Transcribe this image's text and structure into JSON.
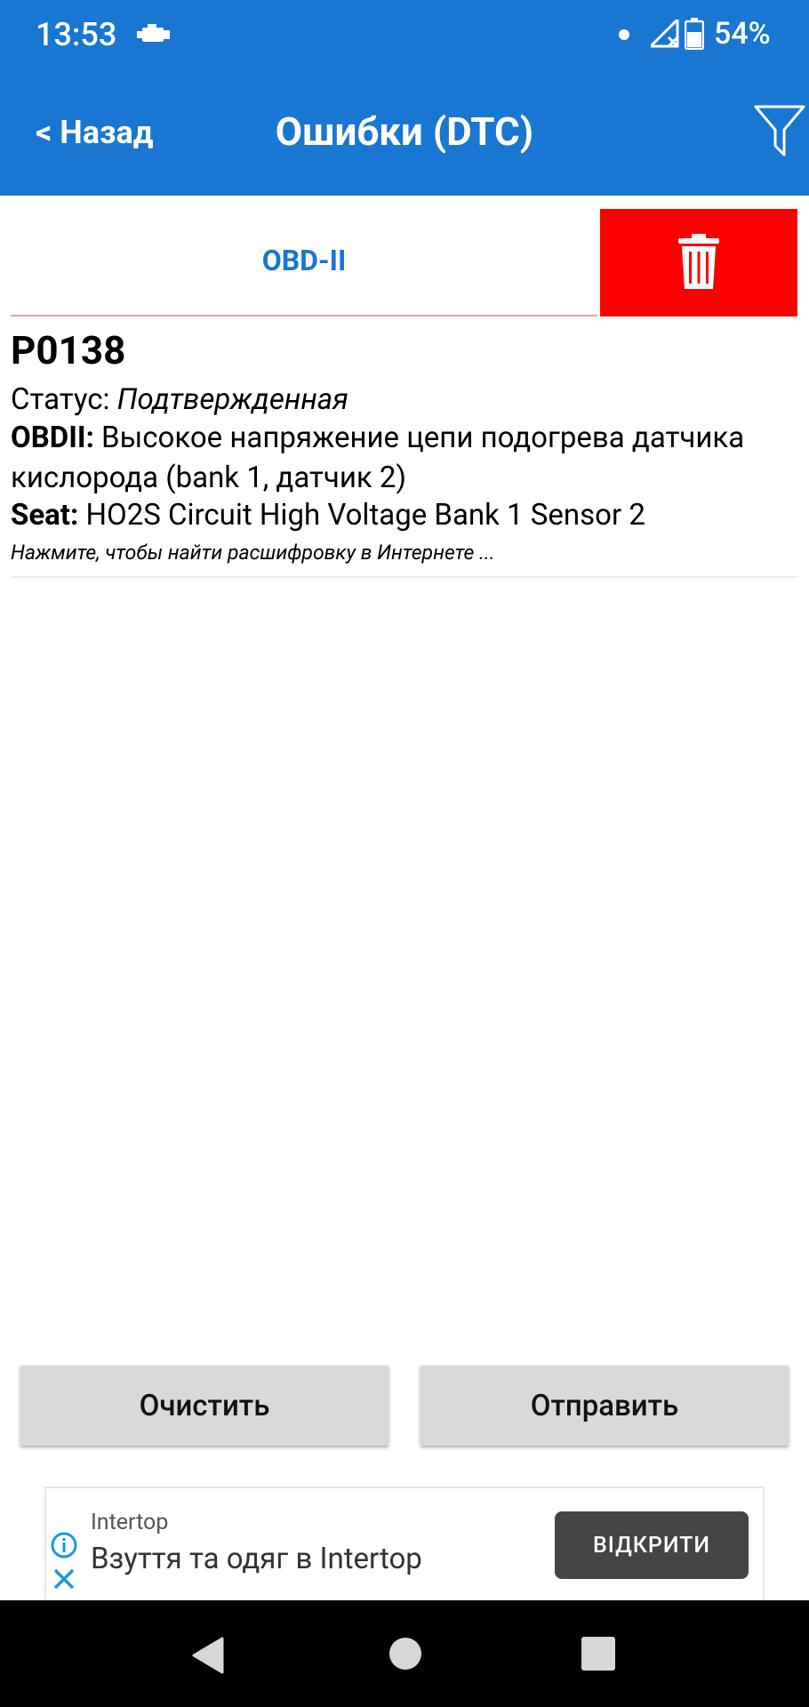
{
  "status_bar": {
    "time": "13:53",
    "battery": "54%"
  },
  "app_bar": {
    "back_label": "< Назад",
    "title": "Ошибки (DTC)"
  },
  "tabs": {
    "obd_label": "OBD-II"
  },
  "dtc": {
    "code": "P0138",
    "status_label": "Статус: ",
    "status_value": "Подтвержденная",
    "obd_label": "OBDII:",
    "obd_desc": " Высокое напряжение цепи подогрева датчика кислорода (bank 1, датчик 2)",
    "seat_label": "Seat:",
    "seat_desc": " HO2S Circuit High Voltage Bank 1 Sensor 2",
    "hint": "Нажмите, чтобы найти расшифровку в Интернете ..."
  },
  "buttons": {
    "clear": "Очистить",
    "send": "Отправить"
  },
  "ad": {
    "brand": "Intertop",
    "title": "Взуття та одяг в Intertop",
    "cta": "ВІДКРИТИ"
  },
  "colors": {
    "app_bar": "#1976D2",
    "delete": "#FF0000",
    "tab_text": "#1976D2"
  }
}
